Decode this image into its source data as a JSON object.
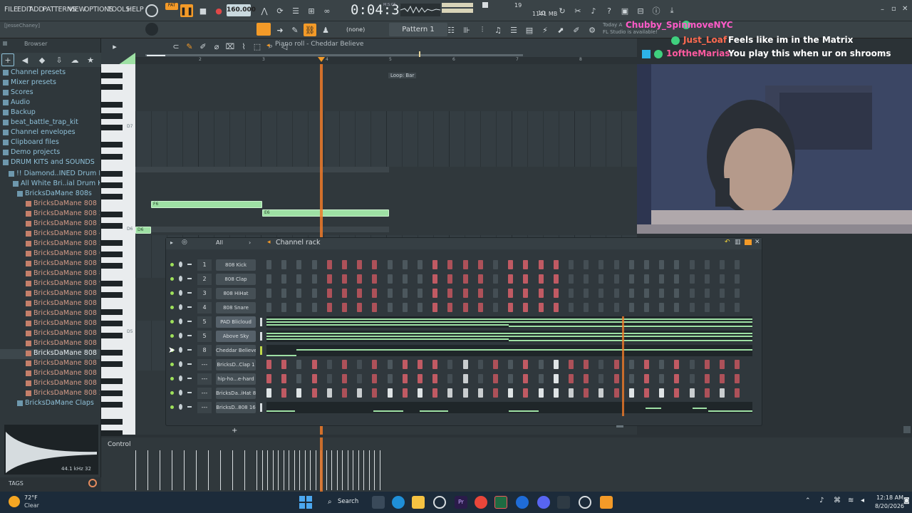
{
  "menubar": {
    "items": [
      "FILE",
      "EDIT",
      "ADD",
      "PATTERNS",
      "VIEW",
      "OPTIONS",
      "TOOLS",
      "HELP"
    ],
    "tempo": "160.000",
    "time": "0:04:37",
    "time_unit": "M:S:CS",
    "memory": "1141 MB",
    "voices": "19",
    "cpu": "10"
  },
  "toolbar2": {
    "user": "[JesseChaney]",
    "pattern": "Pattern 1",
    "channel_select": "(none)",
    "news_line1": "Today A",
    "news_line2": "FL Studio is available!"
  },
  "browser": {
    "title": "Browser",
    "items": [
      {
        "label": "Channel presets",
        "type": "folder"
      },
      {
        "label": "Mixer presets",
        "type": "folder"
      },
      {
        "label": "Scores",
        "type": "folder"
      },
      {
        "label": "Audio",
        "type": "folder"
      },
      {
        "label": "Backup",
        "type": "folder"
      },
      {
        "label": "beat_battle_trap_kit",
        "type": "folder"
      },
      {
        "label": "Channel envelopes",
        "type": "folder"
      },
      {
        "label": "Clipboard files",
        "type": "folder"
      },
      {
        "label": "Demo projects",
        "type": "folder"
      },
      {
        "label": "DRUM KITS  and SOUNDS",
        "type": "folder"
      },
      {
        "label": "!! Diamond..INED Drum Kit",
        "type": "folder"
      },
      {
        "label": "All White Bri..ial Drum Kit",
        "type": "folder"
      },
      {
        "label": "BricksDaMane 808s",
        "type": "folder"
      },
      {
        "label": "BricksDaMane 808 1",
        "type": "file"
      },
      {
        "label": "BricksDaMane 808 2",
        "type": "file"
      },
      {
        "label": "BricksDaMane 808 3",
        "type": "file"
      },
      {
        "label": "BricksDaMane 808 4",
        "type": "file"
      },
      {
        "label": "BricksDaMane 808 5",
        "type": "file"
      },
      {
        "label": "BricksDaMane 808 6",
        "type": "file"
      },
      {
        "label": "BricksDaMane 808 7",
        "type": "file"
      },
      {
        "label": "BricksDaMane 808 8",
        "type": "file"
      },
      {
        "label": "BricksDaMane 808 9",
        "type": "file"
      },
      {
        "label": "BricksDaMane 808 10",
        "type": "file"
      },
      {
        "label": "BricksDaMane 808 11",
        "type": "file"
      },
      {
        "label": "BricksDaMane 808 12",
        "type": "file"
      },
      {
        "label": "BricksDaMane 808 13",
        "type": "file"
      },
      {
        "label": "BricksDaMane 808 14",
        "type": "file"
      },
      {
        "label": "BricksDaMane 808 15",
        "type": "file"
      },
      {
        "label": "BricksDaMane 808 16",
        "type": "file"
      },
      {
        "label": "BricksDaMane 808 17",
        "type": "file"
      },
      {
        "label": "BricksDaMane 808 18",
        "type": "file"
      },
      {
        "label": "BricksDaMane 808 19",
        "type": "file"
      },
      {
        "label": "BricksDaMane 808 20",
        "type": "file"
      },
      {
        "label": "BricksDaMane Claps",
        "type": "folder"
      }
    ],
    "sample_rate": "44.1 kHz 32",
    "tags_label": "TAGS"
  },
  "piano_roll": {
    "title": "Piano roll - Cheddar Believe",
    "bar_numbers": [
      "2",
      "3",
      "4",
      "5",
      "6",
      "7",
      "8"
    ],
    "loop_label": "Loop: Bar",
    "key_labels": [
      "D7",
      "D6",
      "D5"
    ],
    "notes": [
      {
        "label": "F6"
      },
      {
        "label": "E6"
      },
      {
        "label": "D6"
      }
    ],
    "control_label": "Control"
  },
  "chat": [
    {
      "user": "Chubby_SpinmoveNYC",
      "message": "",
      "color": "#ff5ac8"
    },
    {
      "user": "Just_Loaf",
      "message": "Feels like im in the Matrix",
      "color": "#ff6a50"
    },
    {
      "user": "1oftheMarias",
      "message": "You play this when ur on shrooms",
      "color": "#ff5aa0"
    }
  ],
  "channel_rack": {
    "title": "Channel rack",
    "filter": "All",
    "channels": [
      {
        "num": "1",
        "name": "808 Kick",
        "kind": "steps"
      },
      {
        "num": "2",
        "name": "808 Clap",
        "kind": "steps"
      },
      {
        "num": "3",
        "name": "808 HiHat",
        "kind": "steps"
      },
      {
        "num": "4",
        "name": "808 Snare",
        "kind": "steps"
      },
      {
        "num": "5",
        "name": "PAD Blicloud",
        "kind": "roll"
      },
      {
        "num": "5",
        "name": "Above Sky",
        "kind": "roll"
      },
      {
        "num": "8",
        "name": "Cheddar Believe",
        "kind": "roll"
      },
      {
        "num": "---",
        "name": "BricksD..Clap 1",
        "kind": "steps"
      },
      {
        "num": "---",
        "name": "hip-ho...e-hard",
        "kind": "steps"
      },
      {
        "num": "---",
        "name": "BricksDa..iHat 8",
        "kind": "steps"
      },
      {
        "num": "---",
        "name": "BricksD..808 16",
        "kind": "roll"
      }
    ],
    "add_label": "+"
  },
  "taskbar": {
    "weather_temp": "72°F",
    "weather_desc": "Clear",
    "search": "Search",
    "clock_time": "12:18 AM",
    "clock_date": "8/20/2026"
  },
  "colors": {
    "accent_orange": "#f39a28",
    "note_green": "#9ee0a4",
    "step_on": "#c05a63",
    "step_off": "#4c575d"
  }
}
